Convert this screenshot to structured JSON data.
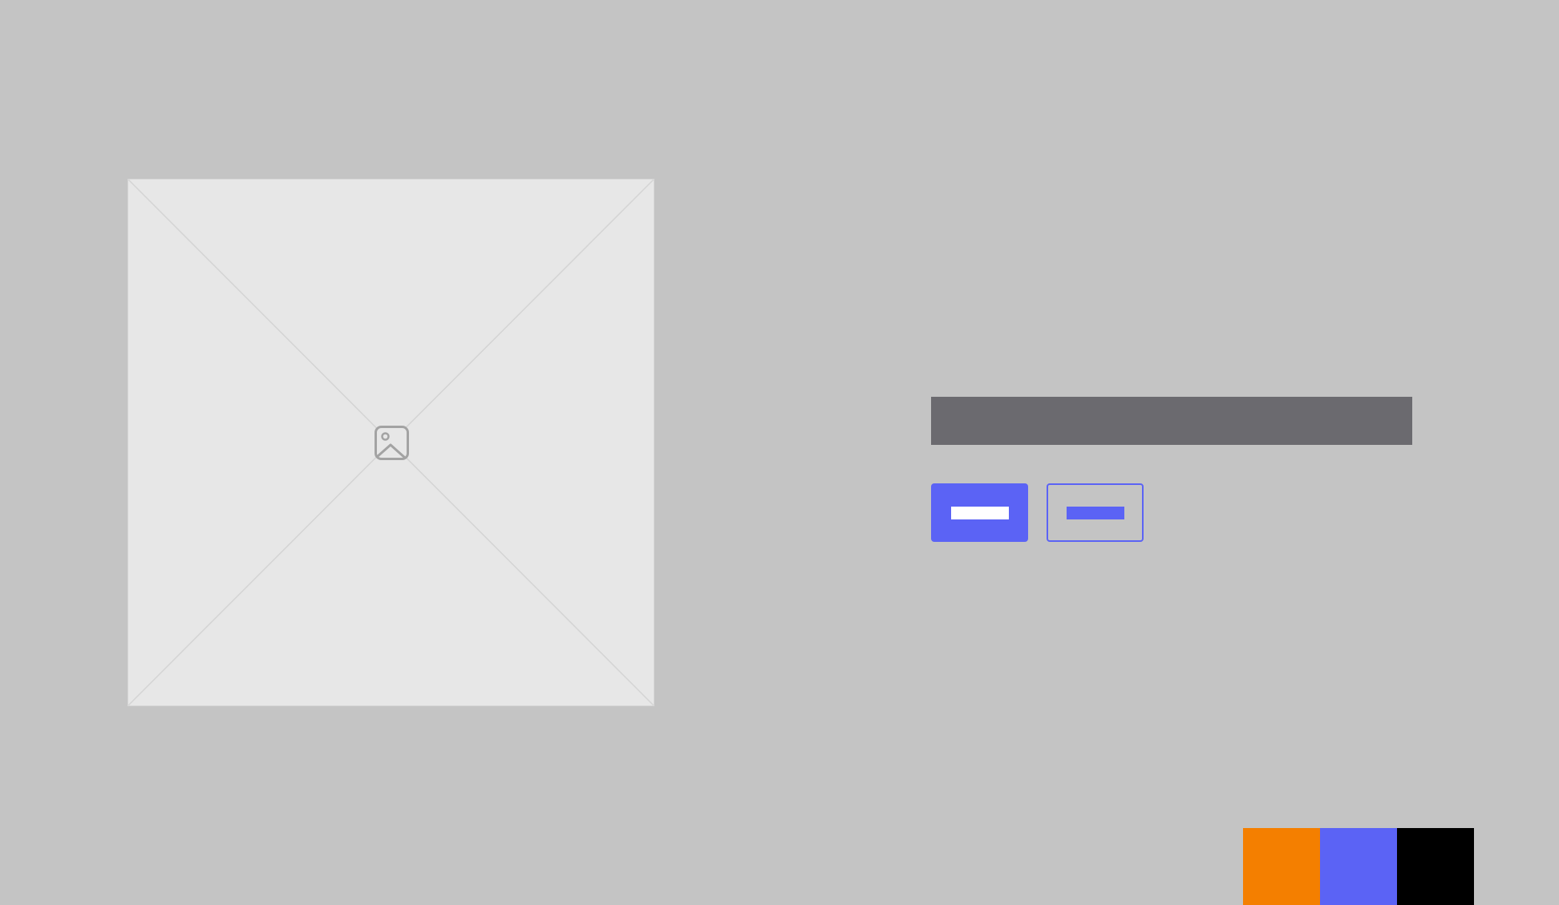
{
  "hero_image": {
    "icon": "image-icon",
    "placeholder_fill": "#e7e7e7",
    "stroke_color": "#d4d4d4",
    "icon_color": "#a3a3a3"
  },
  "heading": {
    "text": "",
    "bar_color": "#6b6a6f"
  },
  "actions": {
    "primary": {
      "label": "",
      "color": "#5b63f5"
    },
    "secondary": {
      "label": "",
      "color": "#5b63f5"
    }
  },
  "palette": {
    "swatches": [
      {
        "name": "orange",
        "color": "#f47f00"
      },
      {
        "name": "blue",
        "color": "#5b63f5"
      },
      {
        "name": "black",
        "color": "#000000"
      }
    ]
  }
}
